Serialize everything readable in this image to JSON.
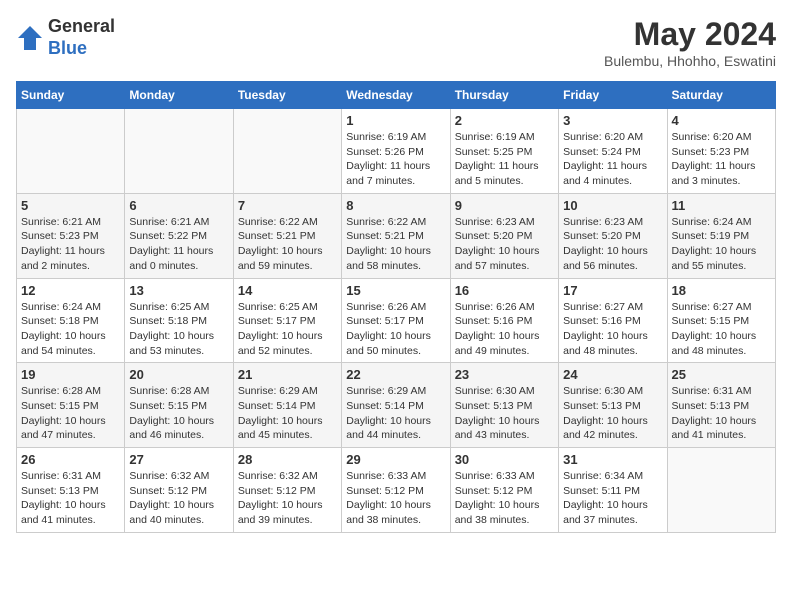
{
  "header": {
    "logo_general": "General",
    "logo_blue": "Blue",
    "month_year": "May 2024",
    "location": "Bulembu, Hhohho, Eswatini"
  },
  "days_of_week": [
    "Sunday",
    "Monday",
    "Tuesday",
    "Wednesday",
    "Thursday",
    "Friday",
    "Saturday"
  ],
  "weeks": [
    {
      "days": [
        {
          "number": "",
          "info": ""
        },
        {
          "number": "",
          "info": ""
        },
        {
          "number": "",
          "info": ""
        },
        {
          "number": "1",
          "info": "Sunrise: 6:19 AM\nSunset: 5:26 PM\nDaylight: 11 hours and 7 minutes."
        },
        {
          "number": "2",
          "info": "Sunrise: 6:19 AM\nSunset: 5:25 PM\nDaylight: 11 hours and 5 minutes."
        },
        {
          "number": "3",
          "info": "Sunrise: 6:20 AM\nSunset: 5:24 PM\nDaylight: 11 hours and 4 minutes."
        },
        {
          "number": "4",
          "info": "Sunrise: 6:20 AM\nSunset: 5:23 PM\nDaylight: 11 hours and 3 minutes."
        }
      ]
    },
    {
      "days": [
        {
          "number": "5",
          "info": "Sunrise: 6:21 AM\nSunset: 5:23 PM\nDaylight: 11 hours and 2 minutes."
        },
        {
          "number": "6",
          "info": "Sunrise: 6:21 AM\nSunset: 5:22 PM\nDaylight: 11 hours and 0 minutes."
        },
        {
          "number": "7",
          "info": "Sunrise: 6:22 AM\nSunset: 5:21 PM\nDaylight: 10 hours and 59 minutes."
        },
        {
          "number": "8",
          "info": "Sunrise: 6:22 AM\nSunset: 5:21 PM\nDaylight: 10 hours and 58 minutes."
        },
        {
          "number": "9",
          "info": "Sunrise: 6:23 AM\nSunset: 5:20 PM\nDaylight: 10 hours and 57 minutes."
        },
        {
          "number": "10",
          "info": "Sunrise: 6:23 AM\nSunset: 5:20 PM\nDaylight: 10 hours and 56 minutes."
        },
        {
          "number": "11",
          "info": "Sunrise: 6:24 AM\nSunset: 5:19 PM\nDaylight: 10 hours and 55 minutes."
        }
      ]
    },
    {
      "days": [
        {
          "number": "12",
          "info": "Sunrise: 6:24 AM\nSunset: 5:18 PM\nDaylight: 10 hours and 54 minutes."
        },
        {
          "number": "13",
          "info": "Sunrise: 6:25 AM\nSunset: 5:18 PM\nDaylight: 10 hours and 53 minutes."
        },
        {
          "number": "14",
          "info": "Sunrise: 6:25 AM\nSunset: 5:17 PM\nDaylight: 10 hours and 52 minutes."
        },
        {
          "number": "15",
          "info": "Sunrise: 6:26 AM\nSunset: 5:17 PM\nDaylight: 10 hours and 50 minutes."
        },
        {
          "number": "16",
          "info": "Sunrise: 6:26 AM\nSunset: 5:16 PM\nDaylight: 10 hours and 49 minutes."
        },
        {
          "number": "17",
          "info": "Sunrise: 6:27 AM\nSunset: 5:16 PM\nDaylight: 10 hours and 48 minutes."
        },
        {
          "number": "18",
          "info": "Sunrise: 6:27 AM\nSunset: 5:15 PM\nDaylight: 10 hours and 48 minutes."
        }
      ]
    },
    {
      "days": [
        {
          "number": "19",
          "info": "Sunrise: 6:28 AM\nSunset: 5:15 PM\nDaylight: 10 hours and 47 minutes."
        },
        {
          "number": "20",
          "info": "Sunrise: 6:28 AM\nSunset: 5:15 PM\nDaylight: 10 hours and 46 minutes."
        },
        {
          "number": "21",
          "info": "Sunrise: 6:29 AM\nSunset: 5:14 PM\nDaylight: 10 hours and 45 minutes."
        },
        {
          "number": "22",
          "info": "Sunrise: 6:29 AM\nSunset: 5:14 PM\nDaylight: 10 hours and 44 minutes."
        },
        {
          "number": "23",
          "info": "Sunrise: 6:30 AM\nSunset: 5:13 PM\nDaylight: 10 hours and 43 minutes."
        },
        {
          "number": "24",
          "info": "Sunrise: 6:30 AM\nSunset: 5:13 PM\nDaylight: 10 hours and 42 minutes."
        },
        {
          "number": "25",
          "info": "Sunrise: 6:31 AM\nSunset: 5:13 PM\nDaylight: 10 hours and 41 minutes."
        }
      ]
    },
    {
      "days": [
        {
          "number": "26",
          "info": "Sunrise: 6:31 AM\nSunset: 5:13 PM\nDaylight: 10 hours and 41 minutes."
        },
        {
          "number": "27",
          "info": "Sunrise: 6:32 AM\nSunset: 5:12 PM\nDaylight: 10 hours and 40 minutes."
        },
        {
          "number": "28",
          "info": "Sunrise: 6:32 AM\nSunset: 5:12 PM\nDaylight: 10 hours and 39 minutes."
        },
        {
          "number": "29",
          "info": "Sunrise: 6:33 AM\nSunset: 5:12 PM\nDaylight: 10 hours and 38 minutes."
        },
        {
          "number": "30",
          "info": "Sunrise: 6:33 AM\nSunset: 5:12 PM\nDaylight: 10 hours and 38 minutes."
        },
        {
          "number": "31",
          "info": "Sunrise: 6:34 AM\nSunset: 5:11 PM\nDaylight: 10 hours and 37 minutes."
        },
        {
          "number": "",
          "info": ""
        }
      ]
    }
  ]
}
